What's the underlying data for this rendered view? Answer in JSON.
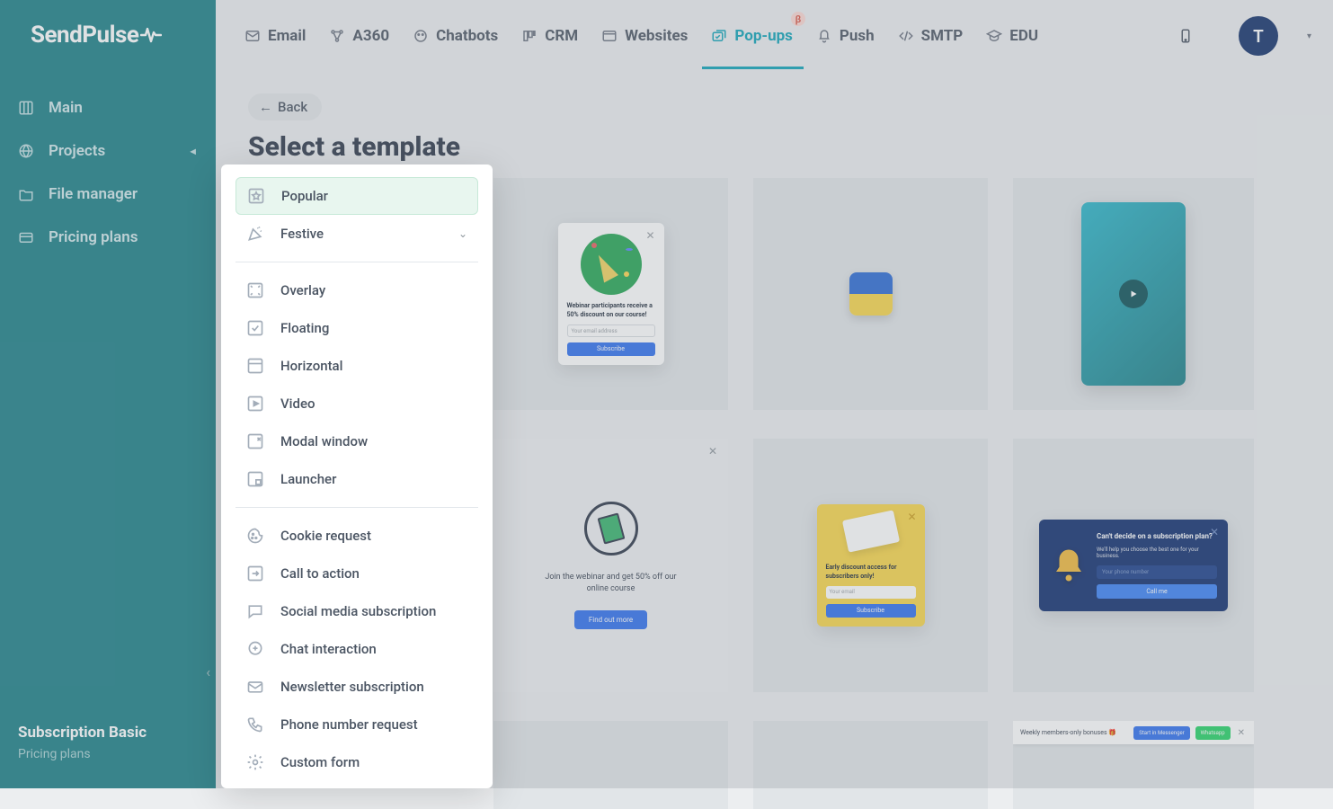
{
  "brand": "SendPulse",
  "topnav": [
    {
      "id": "email",
      "label": "Email"
    },
    {
      "id": "a360",
      "label": "A360"
    },
    {
      "id": "chatbots",
      "label": "Chatbots"
    },
    {
      "id": "crm",
      "label": "CRM"
    },
    {
      "id": "websites",
      "label": "Websites"
    },
    {
      "id": "popups",
      "label": "Pop-ups",
      "active": true,
      "beta": "β"
    },
    {
      "id": "push",
      "label": "Push"
    },
    {
      "id": "smtp",
      "label": "SMTP"
    },
    {
      "id": "edu",
      "label": "EDU"
    }
  ],
  "avatar_initial": "T",
  "sidebar": {
    "items": [
      {
        "id": "main",
        "label": "Main"
      },
      {
        "id": "projects",
        "label": "Projects",
        "expandable": true
      },
      {
        "id": "file-manager",
        "label": "File manager"
      },
      {
        "id": "pricing-plans",
        "label": "Pricing plans"
      }
    ],
    "footer": {
      "title": "Subscription Basic",
      "link": "Pricing plans"
    }
  },
  "page": {
    "back_label": "Back",
    "title": "Select a template"
  },
  "categories": [
    {
      "id": "popular",
      "label": "Popular",
      "active": true
    },
    {
      "id": "festive",
      "label": "Festive",
      "expandable": true
    },
    {
      "divider": true
    },
    {
      "id": "overlay",
      "label": "Overlay"
    },
    {
      "id": "floating",
      "label": "Floating"
    },
    {
      "id": "horizontal",
      "label": "Horizontal"
    },
    {
      "id": "video",
      "label": "Video"
    },
    {
      "id": "modal-window",
      "label": "Modal window"
    },
    {
      "id": "launcher",
      "label": "Launcher"
    },
    {
      "divider": true
    },
    {
      "id": "cookie-request",
      "label": "Cookie request"
    },
    {
      "id": "call-to-action",
      "label": "Call to action"
    },
    {
      "id": "social-media-subscription",
      "label": "Social media subscription"
    },
    {
      "id": "chat-interaction",
      "label": "Chat interaction"
    },
    {
      "id": "newsletter-subscription",
      "label": "Newsletter subscription"
    },
    {
      "id": "phone-number-request",
      "label": "Phone number request"
    },
    {
      "id": "custom-form",
      "label": "Custom form"
    }
  ],
  "templates": {
    "c1": {
      "headline": "Webinar participants receive a 50% discount on our course!",
      "placeholder": "Your email address",
      "button": "Subscribe"
    },
    "c4": {
      "text": "Join the webinar and get 50% off our online course",
      "button": "Find out more"
    },
    "c5": {
      "headline": "Early discount access for subscribers only!",
      "placeholder": "Your email",
      "button": "Subscribe"
    },
    "c6": {
      "heading": "Can't decide on a subscription plan?",
      "sub": "We'll help you choose the best one for your business.",
      "placeholder": "Your phone number",
      "button": "Call me"
    },
    "c8": {
      "text": "Weekly members-only bonuses 🎁",
      "button1": "Start in Messenger",
      "button2": "Whatsapp"
    }
  }
}
